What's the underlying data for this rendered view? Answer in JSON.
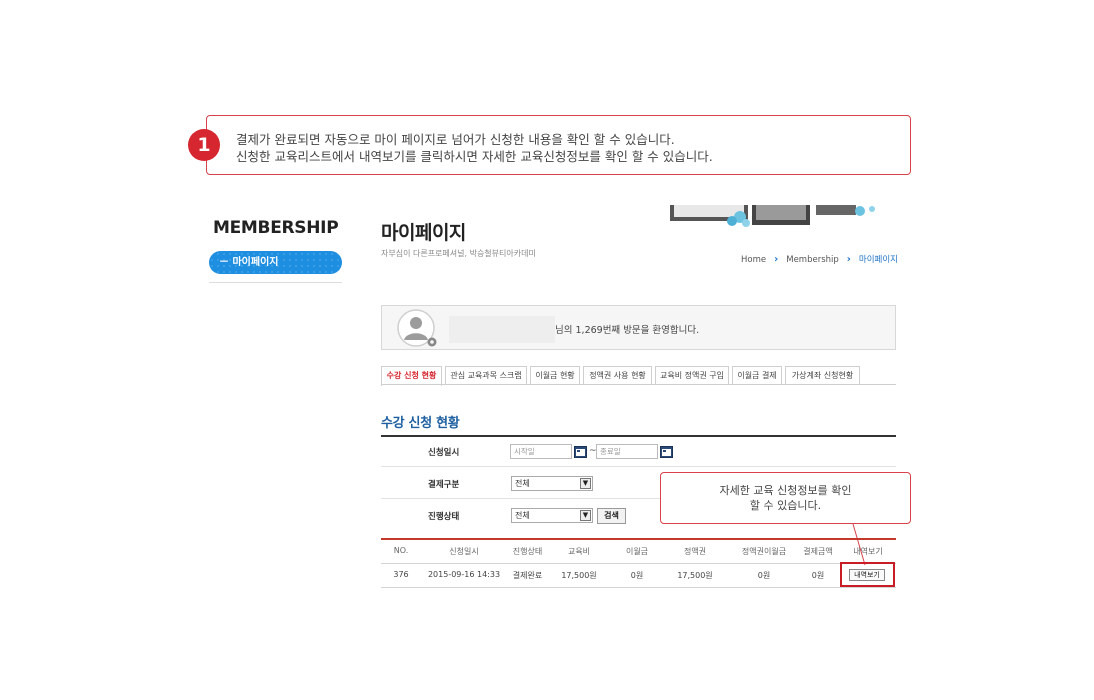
{
  "step": {
    "number": "1",
    "line1": "결제가 완료되면 자동으로 마이 페이지로 넘어가 신청한 내용을 확인 할 수 있습니다.",
    "line2": "신청한 교육리스트에서 내역보기를 클릭하시면 자세한 교육신청정보를 확인 할 수 있습니다."
  },
  "sidebar": {
    "title": "MEMBERSHIP",
    "active_item": "－ 마이페이지"
  },
  "header": {
    "title": "마이페이지",
    "subtitle": "자부심이 다른프로페셔널, 박승철뷰티아카데미",
    "breadcrumb": {
      "home": "Home",
      "membership": "Membership",
      "current": "마이페이지",
      "separator": "›"
    }
  },
  "welcome": {
    "text": "님의 1,269번째 방문을 환영합니다."
  },
  "tabs": [
    {
      "label": "수강 신청 현황"
    },
    {
      "label": "관심 교육과목 스크랩"
    },
    {
      "label": "이월금 현황"
    },
    {
      "label": "정액권 사용 현황"
    },
    {
      "label": "교육비 정액권 구입"
    },
    {
      "label": "이월금 결제"
    },
    {
      "label": "가상계좌 신청현황"
    }
  ],
  "section_title": "수강 신청 현황",
  "filters": {
    "date_label": "신청일시",
    "start_placeholder": "시작일",
    "end_placeholder": "종료일",
    "tilde": "~",
    "payment_label": "결제구분",
    "payment_value": "전체",
    "status_label": "진행상태",
    "status_value": "전체",
    "search_label": "검색"
  },
  "tip": {
    "line1": "자세한 교육 신청정보를 확인",
    "line2": "할 수 있습니다."
  },
  "table": {
    "headers": [
      "NO.",
      "신청일시",
      "진행상태",
      "교육비",
      "이월금",
      "정액권",
      "정액권이월금",
      "결제금액",
      "내역보기"
    ],
    "rows": [
      {
        "no": "376",
        "date": "2015-09-16 14:33",
        "status": "결제완료",
        "fee": "17,500원",
        "carryover": "0원",
        "voucher": "17,500원",
        "voucher_carryover": "0원",
        "payment": "0원",
        "detail_button": "내역보기"
      }
    ]
  },
  "colors": {
    "accent_red": "#d6262f",
    "sidebar_blue": "#1e8ee0",
    "title_blue": "#1d5fa0"
  }
}
